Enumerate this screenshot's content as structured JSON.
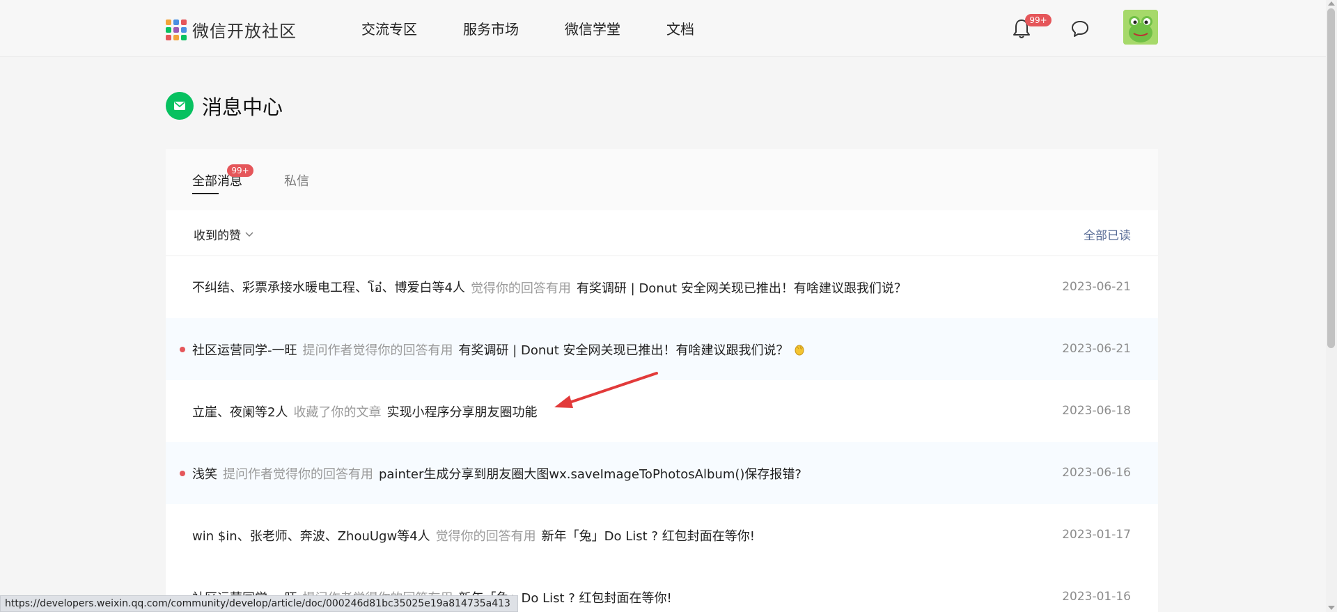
{
  "header": {
    "brand": "微信开放社区",
    "nav": [
      "交流专区",
      "服务市场",
      "微信学堂",
      "文档"
    ],
    "notification_badge": "99+"
  },
  "page": {
    "title": "消息中心"
  },
  "tabs": {
    "all": "全部消息",
    "all_badge": "99+",
    "private": "私信"
  },
  "filter": {
    "label": "收到的赞",
    "mark_all_read": "全部已读"
  },
  "messages": [
    {
      "users": "不纠结、彩票承接水暖电工程、โอ๋、博爱白等4人",
      "action": "觉得你的回答有用",
      "title": "有奖调研 | Donut 安全网关现已推出！有啥建议跟我们说？",
      "date": "2023-06-21",
      "unread": false
    },
    {
      "users": "社区运营同学-一旺",
      "action": "提问作者觉得你的回答有用",
      "title": "有奖调研 | Donut 安全网关现已推出！有啥建议跟我们说？",
      "date": "2023-06-21",
      "unread": true
    },
    {
      "users": "立崖、夜阑等2人",
      "action": "收藏了你的文章",
      "title": "实现小程序分享朋友圈功能",
      "date": "2023-06-18",
      "unread": false
    },
    {
      "users": "浅笑",
      "action": "提问作者觉得你的回答有用",
      "title": "painter生成分享到朋友圈大图wx.saveImageToPhotosAlbum()保存报错?",
      "date": "2023-06-16",
      "unread": true
    },
    {
      "users": "win $in、张老师、奔波、ZhouUgw等4人",
      "action": "觉得你的回答有用",
      "title": "新年「兔」Do List ? 红包封面在等你!",
      "date": "2023-01-17",
      "unread": false
    },
    {
      "users": "社区运营同学-一旺",
      "action": "提问作者觉得你的回答有用",
      "title": "新年「兔」Do List ? 红包封面在等你!",
      "date": "2023-01-16",
      "unread": false
    }
  ],
  "status_url": "https://developers.weixin.qq.com/community/develop/article/doc/000246d81bc35025e19a814735a413",
  "colors": {
    "accent_green": "#07c160",
    "badge_red": "#e5565a",
    "link_blue": "#576b95"
  }
}
